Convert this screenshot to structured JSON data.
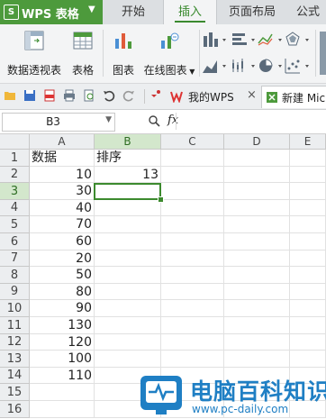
{
  "app": {
    "name": "WPS 表格"
  },
  "tabs": [
    {
      "label": "开始"
    },
    {
      "label": "插入"
    },
    {
      "label": "页面布局"
    },
    {
      "label": "公式"
    }
  ],
  "ribbon": {
    "pivot_label": "数据透视表",
    "table_label": "表格",
    "chart_label": "图表",
    "online_chart_label": "在线图表"
  },
  "doc_tabs": [
    {
      "label": "我的WPS"
    },
    {
      "label": "新建 Mic"
    }
  ],
  "formula_bar": {
    "cell_ref": "B3",
    "fx": "fx",
    "value": ""
  },
  "sheet": {
    "columns": [
      "A",
      "B",
      "C",
      "D",
      "E"
    ],
    "rows": [
      "1",
      "2",
      "3",
      "4",
      "5",
      "6",
      "7",
      "8",
      "9",
      "10",
      "11",
      "12",
      "13",
      "14",
      "15",
      "16"
    ],
    "header_a": "数据",
    "header_b": "排序",
    "col_a": [
      "10",
      "30",
      "40",
      "70",
      "60",
      "20",
      "50",
      "80",
      "90",
      "130",
      "120",
      "100",
      "110"
    ],
    "b2": "13",
    "selected": "B3"
  },
  "watermark": {
    "title": "电脑百科知识",
    "url": "www.pc-daily.com"
  },
  "colors": {
    "accent": "#4d9a3c",
    "selection": "#3c8a2e"
  }
}
